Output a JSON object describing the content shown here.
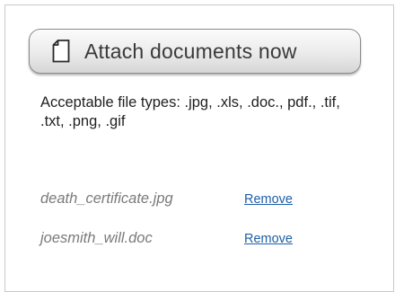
{
  "attach": {
    "button_label": "Attach documents now",
    "icon": "document-icon"
  },
  "file_types_text": "Acceptable file types: .jpg, .xls, .doc., pdf., .tif, .txt, .png, .gif",
  "files": [
    {
      "name": "death_certificate.jpg",
      "action_label": "Remove"
    },
    {
      "name": "joesmith_will.doc",
      "action_label": "Remove"
    }
  ],
  "colors": {
    "link": "#1f5fa8",
    "file_name": "#7a7a7a",
    "panel_border": "#c9c9c9"
  }
}
